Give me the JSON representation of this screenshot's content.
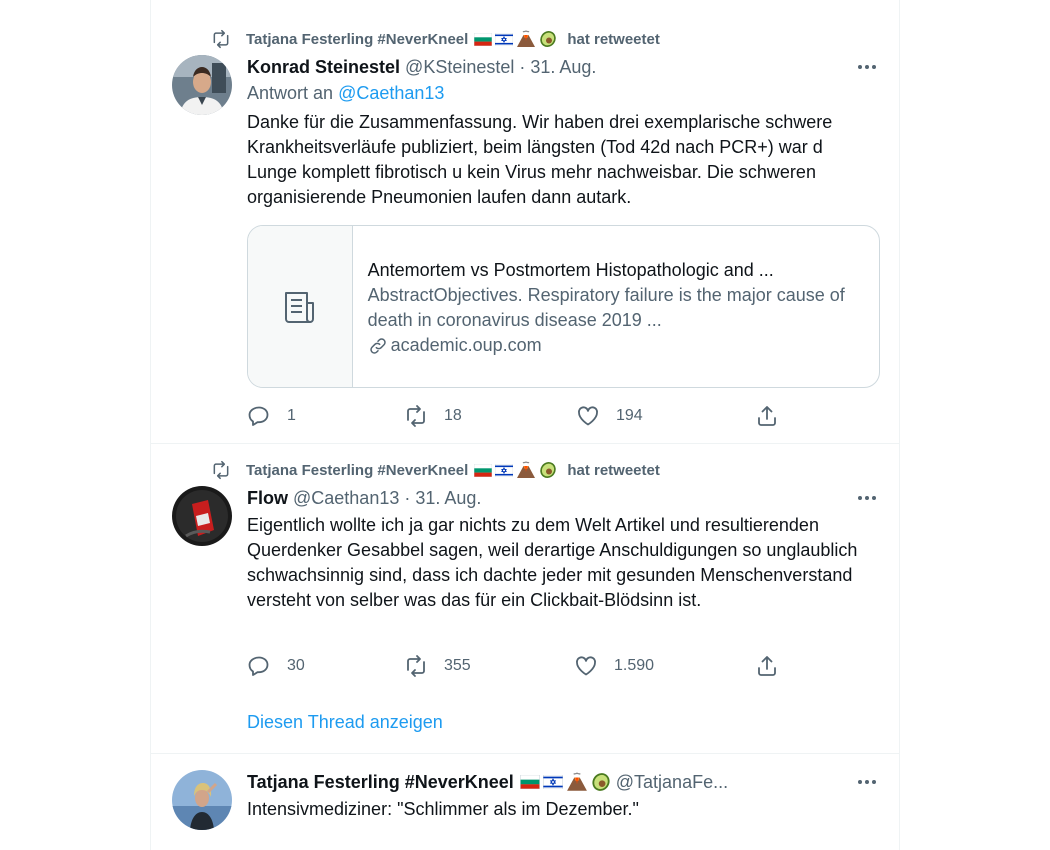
{
  "tweets": [
    {
      "retweeted_by": "Tatjana Festerling #NeverKneel",
      "retweet_suffix": "hat retweetet",
      "author_name": "Konrad Steinestel",
      "author_handle": "@KSteinestel",
      "separator": "·",
      "date": "31. Aug.",
      "reply_prefix": "Antwort an",
      "reply_mention": "@Caethan13",
      "text": "Danke für die Zusammenfassung. Wir haben drei exemplarische schwere Krankheitsverläufe publiziert, beim längsten (Tod 42d nach PCR+) war d Lunge komplett fibrotisch u kein Virus mehr nachweisbar. Die schweren organisierende Pneumonien laufen dann autark.",
      "card": {
        "title": "Antemortem vs Postmortem Histopathologic and ...",
        "description": "AbstractObjectives. Respiratory failure is the major cause of death in coronavirus disease 2019 ...",
        "domain": "academic.oup.com"
      },
      "replies": "1",
      "retweets": "18",
      "likes": "194"
    },
    {
      "retweeted_by": "Tatjana Festerling #NeverKneel",
      "retweet_suffix": "hat retweetet",
      "author_name": "Flow",
      "author_handle": "@Caethan13",
      "separator": "·",
      "date": "31. Aug.",
      "text": "Eigentlich wollte ich ja gar nichts zu dem Welt Artikel und resultierenden Querdenker Gesabbel sagen, weil derartige Anschuldigungen so unglaublich schwachsinnig sind, dass ich dachte jeder mit gesunden Menschenverstand versteht von selber was das für ein Clickbait-Blödsinn ist.",
      "replies": "30",
      "retweets": "355",
      "likes": "1.590",
      "thread_link": "Diesen Thread anzeigen"
    },
    {
      "author_name": "Tatjana Festerling #NeverKneel",
      "author_handle": "@TatjanaFe...",
      "text": "Intensivmediziner: \"Schlimmer als im Dezember.\""
    }
  ],
  "icons": {
    "retweet": "retweet-icon",
    "more": "more-icon",
    "reply": "reply-icon",
    "like": "like-icon",
    "share": "share-icon",
    "article": "article-icon",
    "link": "link-icon",
    "flags": [
      "bulgaria-flag-icon",
      "israel-flag-icon",
      "volcano-icon",
      "avocado-icon"
    ]
  },
  "colors": {
    "accent": "#1d9bf0",
    "secondary_text": "#536471",
    "primary_text": "#0f1419",
    "border": "#cfd9de"
  }
}
